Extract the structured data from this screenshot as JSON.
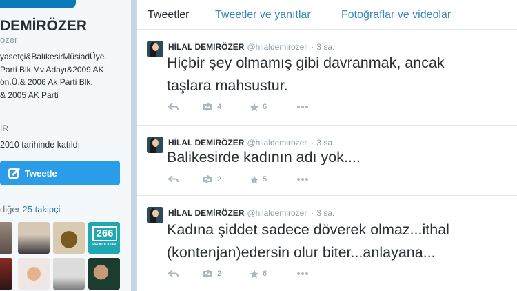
{
  "profile": {
    "name": "DEMİRÖZER",
    "handle": "özer",
    "bio": [
      "yasetçi&BalıkesirMüsiadÜye.",
      "Parti Blk.Mv.Adayı&2009 AK",
      "ön.Ü.& 2006 Ak Parti Blk.",
      "& 2005 AK Parti",
      "."
    ],
    "location": "İR",
    "joined": "2010 tarihinde katıldı",
    "tweet_button_label": "Tweetle",
    "followers_prefix": "diğer",
    "followers_link": "25 takipçi",
    "thumb_266_label": "266",
    "thumb_266_sub": "PRODUCTION"
  },
  "tabs": [
    {
      "label": "Tweetler",
      "active": true
    },
    {
      "label": "Tweetler ve yanıtlar",
      "active": false
    },
    {
      "label": "Fotoğraflar ve videolar",
      "active": false
    }
  ],
  "tweets": [
    {
      "name": "HİLAL DEMİRÖZER",
      "handle": "@hilaldemirozer",
      "time": "3 sa.",
      "lines": [
        "Hiçbir şey olmamış gibi davranmak, ancak",
        "taşlara mahsustur."
      ],
      "retweets": "4",
      "favorites": "6"
    },
    {
      "name": "HİLAL DEMİRÖZER",
      "handle": "@hilaldemirozer",
      "time": "3 sa.",
      "lines": [
        "Balikesirde kadının adı yok...."
      ],
      "retweets": "2",
      "favorites": "5"
    },
    {
      "name": "HİLAL DEMİRÖZER",
      "handle": "@hilaldemirozer",
      "time": "3 sa.",
      "lines": [
        "Kadına şiddet sadece döverek olmaz...ithal",
        "(kontenjan)edersin olur biter...anlayana..."
      ],
      "retweets": "2",
      "favorites": "6"
    }
  ],
  "colors": {
    "accent": "#2b9de8",
    "link": "#3b88c3",
    "text": "#292f33",
    "muted": "#8899a6"
  }
}
